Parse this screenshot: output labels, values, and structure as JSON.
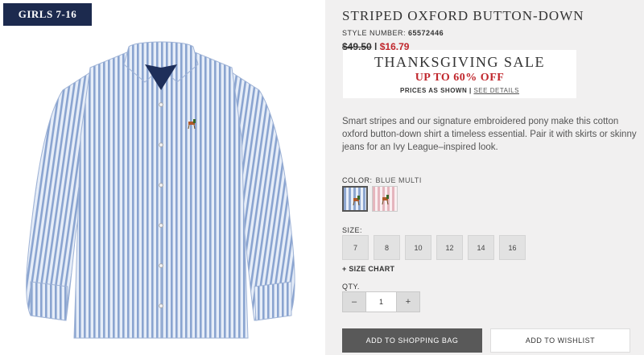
{
  "category_badge": "GIRLS 7-16",
  "product": {
    "title": "STRIPED OXFORD BUTTON-DOWN",
    "style_label": "STYLE NUMBER:",
    "style_number": "65572446",
    "old_price": "$49.50",
    "price_separator": "|",
    "new_price": "$16.79",
    "description": "Smart stripes and our signature embroidered pony make this cotton oxford button-down shirt a timeless essential. Pair it with skirts or skinny jeans for an Ivy League–inspired look."
  },
  "promo": {
    "headline": "THANKSGIVING SALE",
    "subhead": "UP TO 60% OFF",
    "note": "PRICES AS SHOWN",
    "divider": "|",
    "link": "SEE DETAILS"
  },
  "color": {
    "label": "COLOR:",
    "selected": "BLUE MULTI",
    "swatches": [
      {
        "name": "blue-multi",
        "color": "#8ea7d1",
        "selected": true
      },
      {
        "name": "pink-multi",
        "color": "#e5b5bd",
        "selected": false
      }
    ]
  },
  "size": {
    "label": "SIZE:",
    "options": [
      "7",
      "8",
      "10",
      "12",
      "14",
      "16"
    ],
    "chart_link": "+ SIZE CHART"
  },
  "quantity": {
    "label": "QTY.",
    "minus": "–",
    "value": "1",
    "plus": "+"
  },
  "actions": {
    "add_to_bag": "ADD TO SHOPPING BAG",
    "add_to_wishlist": "ADD TO WISHLIST"
  },
  "colors": {
    "badge_bg": "#1c2a4e",
    "sale_red": "#c0272d",
    "panel_bg": "#f1f0f0",
    "bag_button_bg": "#595959"
  }
}
